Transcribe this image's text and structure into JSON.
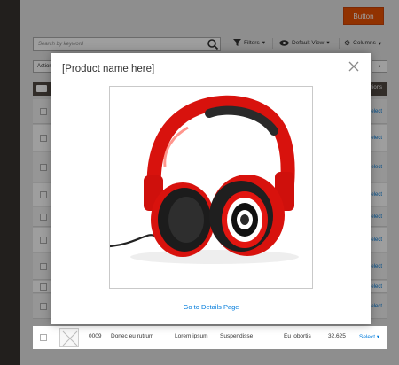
{
  "header": {
    "button_label": "Button"
  },
  "search": {
    "placeholder": "Search by keyword"
  },
  "toolbar": {
    "filters_label": "Filters",
    "view_label": "Default View",
    "columns_label": "Columns"
  },
  "grid": {
    "actions_label": "Actions",
    "header_right_label": "Actions",
    "select_label": "Select"
  },
  "last_row": {
    "id": "0009",
    "name": "Donec eu rutrum",
    "col3": "Lorem ipsum",
    "col4": "Suspendisse",
    "col5": "Eu lobortis",
    "col6": "32,625",
    "select_label": "Select"
  },
  "modal": {
    "title": "[Product name here]",
    "details_link": "Go to Details Page",
    "image_alt": "red-headphones"
  },
  "colors": {
    "accent": "#eb5202",
    "link": "#007bdb",
    "header_dark": "#514943",
    "sidebar": "#373330"
  }
}
